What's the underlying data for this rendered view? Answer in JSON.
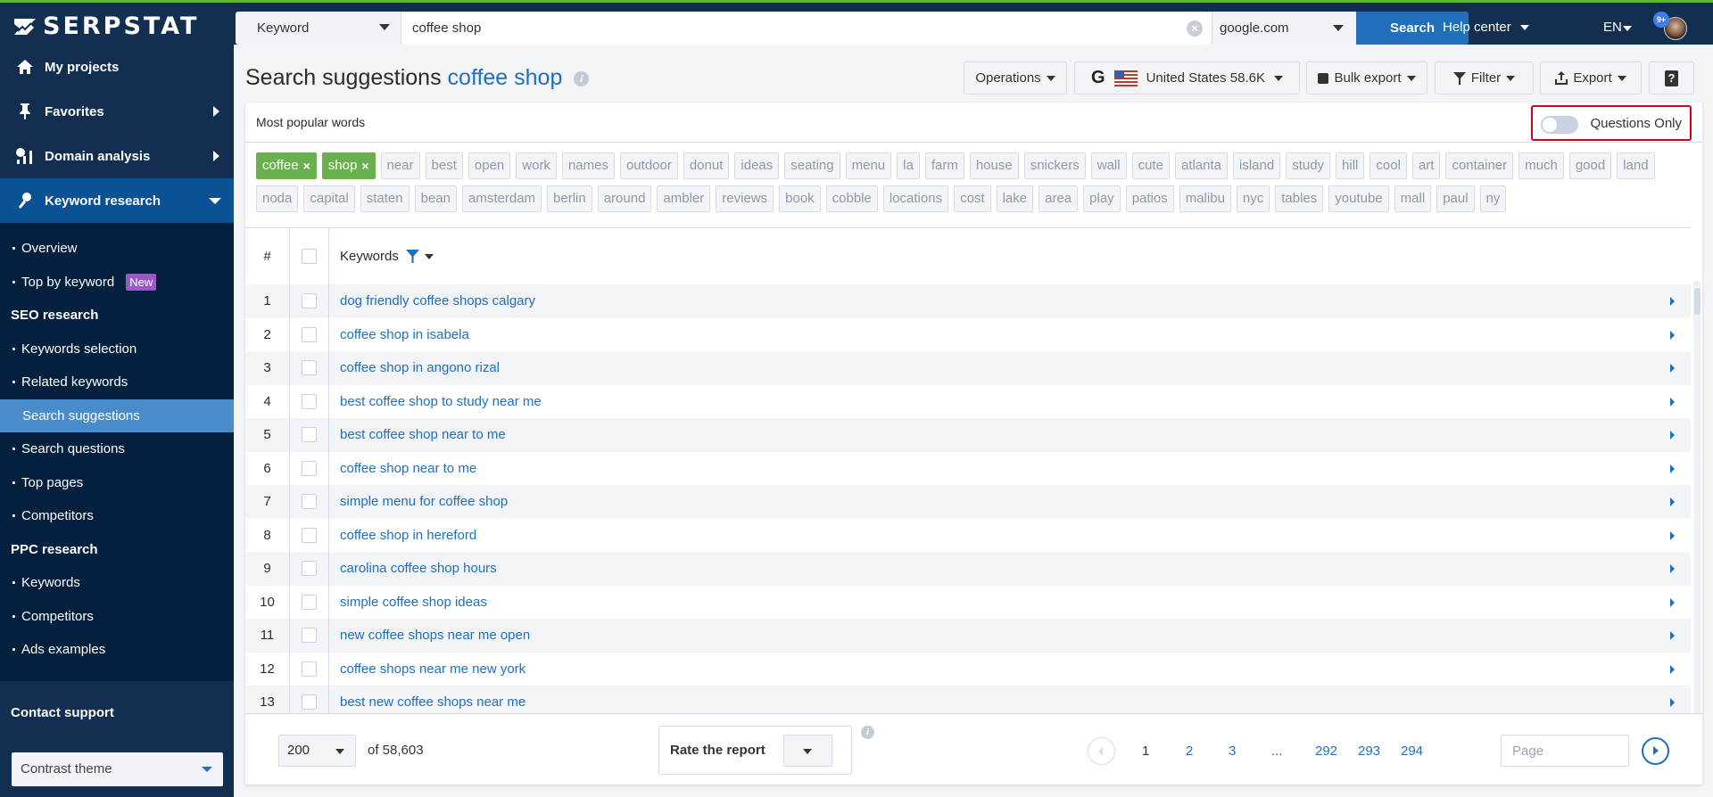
{
  "app": {
    "brand": "SERPSTAT"
  },
  "topbar": {
    "search_type": "Keyword",
    "search_value": "coffee shop",
    "engine": "google.com",
    "search_button": "Search",
    "help_center": "Help center",
    "language": "EN",
    "notification_count": "9+"
  },
  "sidebar": {
    "main_items": [
      {
        "label": "My projects",
        "icon": "home-icon"
      },
      {
        "label": "Favorites",
        "icon": "pin-icon"
      },
      {
        "label": "Domain analysis",
        "icon": "chart-icon"
      },
      {
        "label": "Keyword research",
        "icon": "key-icon"
      }
    ],
    "overview": "Overview",
    "top_by_keyword": "Top by keyword",
    "new_badge": "New",
    "seo_section": "SEO research",
    "seo_items": [
      "Keywords selection",
      "Related keywords",
      "Search suggestions",
      "Search questions",
      "Top pages",
      "Competitors"
    ],
    "ppc_section": "PPC research",
    "ppc_items": [
      "Keywords",
      "Competitors",
      "Ads examples"
    ],
    "contact_support": "Contact support",
    "theme": "Contrast theme"
  },
  "page": {
    "title_prefix": "Search suggestions",
    "title_keyword": "coffee shop",
    "toolbar": {
      "operations": "Operations",
      "region": "United States 58.6K",
      "bulk_export": "Bulk export",
      "filter": "Filter",
      "export": "Export",
      "help": "?"
    }
  },
  "popular_words": {
    "label": "Most popular words",
    "questions_only": "Questions Only",
    "questions_only_enabled": false,
    "selected": [
      "coffee",
      "shop"
    ],
    "words": [
      "near",
      "best",
      "open",
      "work",
      "names",
      "outdoor",
      "donut",
      "ideas",
      "seating",
      "menu",
      "la",
      "farm",
      "house",
      "snickers",
      "wall",
      "cute",
      "atlanta",
      "island",
      "study",
      "hill",
      "cool",
      "art",
      "container",
      "much",
      "good",
      "land",
      "noda",
      "capital",
      "staten",
      "bean",
      "amsterdam",
      "berlin",
      "around",
      "ambler",
      "reviews",
      "book",
      "cobble",
      "locations",
      "cost",
      "lake",
      "area",
      "play",
      "patios",
      "malibu",
      "nyc",
      "tables",
      "youtube",
      "mall",
      "paul",
      "ny"
    ]
  },
  "table": {
    "col_num": "#",
    "col_keywords": "Keywords",
    "rows": [
      {
        "n": "1",
        "keyword": "dog friendly coffee shops calgary"
      },
      {
        "n": "2",
        "keyword": "coffee shop in isabela"
      },
      {
        "n": "3",
        "keyword": "coffee shop in angono rizal"
      },
      {
        "n": "4",
        "keyword": "best coffee shop to study near me"
      },
      {
        "n": "5",
        "keyword": "best coffee shop near to me"
      },
      {
        "n": "6",
        "keyword": "coffee shop near to me"
      },
      {
        "n": "7",
        "keyword": "simple menu for coffee shop"
      },
      {
        "n": "8",
        "keyword": "coffee shop in hereford"
      },
      {
        "n": "9",
        "keyword": "carolina coffee shop hours"
      },
      {
        "n": "10",
        "keyword": "simple coffee shop ideas"
      },
      {
        "n": "11",
        "keyword": "new coffee shops near me open"
      },
      {
        "n": "12",
        "keyword": "coffee shops near me new york"
      },
      {
        "n": "13",
        "keyword": "best new coffee shops near me"
      }
    ]
  },
  "footer": {
    "per_page": "200",
    "total": "of 58,603",
    "rate_label": "Rate the report",
    "pages": [
      "1",
      "2",
      "3",
      "...",
      "292",
      "293",
      "294"
    ],
    "current_page": "1",
    "page_placeholder": "Page"
  },
  "colors": {
    "accent": "#1f6fbd",
    "sidebar": "#04203f",
    "topbar": "#122f52",
    "tag_selected": "#6ab04c",
    "highlight_border": "#d0021b"
  }
}
